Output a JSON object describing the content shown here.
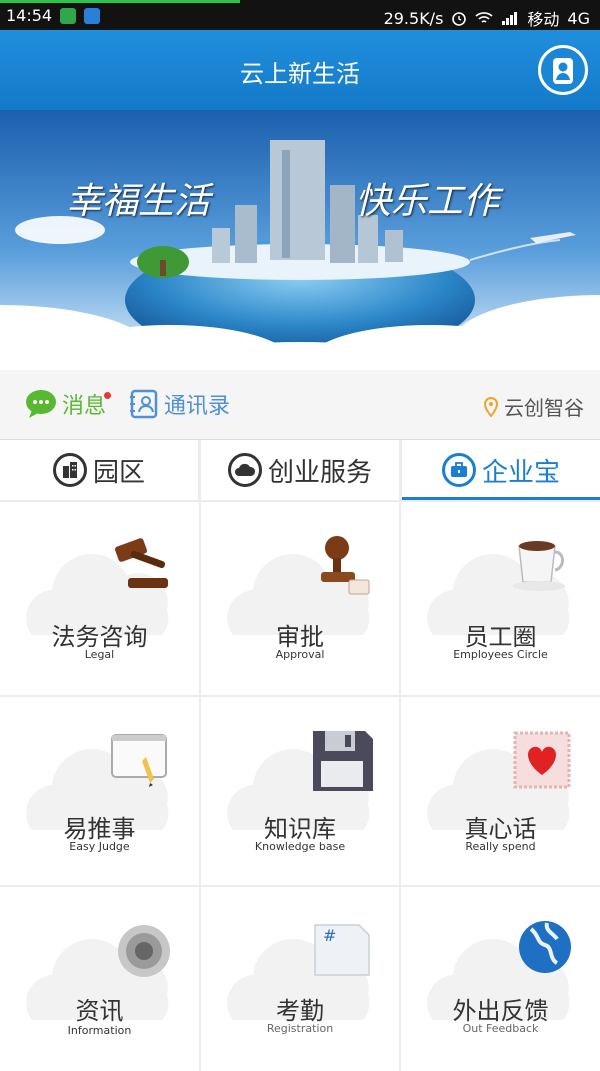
{
  "status_bar": {
    "time": "14:54",
    "speed": "29.5K/s",
    "carrier": "移动",
    "network": "4G",
    "icons": [
      "shield-icon",
      "cloud-app-icon",
      "alarm-icon",
      "wifi-icon",
      "signal-icon",
      "battery-icon"
    ]
  },
  "header": {
    "title": "云上新生活",
    "avatar_icon": "user-profile-icon"
  },
  "banner": {
    "slogan_left": "幸福生活",
    "slogan_right": "快乐工作"
  },
  "infobar": {
    "messages_label": "消息",
    "contacts_label": "通讯录",
    "location_label": "云创智谷"
  },
  "tabs": [
    {
      "label": "园区",
      "icon": "building-icon",
      "active": false
    },
    {
      "label": "创业服务",
      "icon": "cloud-icon",
      "active": false
    },
    {
      "label": "企业宝",
      "icon": "briefcase-icon",
      "active": true
    }
  ],
  "grid": [
    {
      "cn": "法务咨询",
      "en": "Legal",
      "icon": "gavel-icon"
    },
    {
      "cn": "审批",
      "en": "Approval",
      "icon": "stamp-icon"
    },
    {
      "cn": "员工圈",
      "en": "Employees Circle",
      "icon": "coffee-cup-icon"
    },
    {
      "cn": "易推事",
      "en": "Easy Judge",
      "icon": "notepad-pencil-icon"
    },
    {
      "cn": "知识库",
      "en": "Knowledge base",
      "icon": "floppy-disk-icon"
    },
    {
      "cn": "真心话",
      "en": "Really spend",
      "icon": "heart-stamp-icon"
    },
    {
      "cn": "资讯",
      "en": "Information",
      "icon": "speaker-icon"
    },
    {
      "cn": "考勤",
      "en": "Registration",
      "icon": "hashtag-card-icon"
    },
    {
      "cn": "外出反馈",
      "en": "Out Feedback",
      "icon": "globe-icon"
    }
  ],
  "colors": {
    "header_blue": "#1a86d6",
    "active_tab": "#1a7fd0",
    "message_green": "#59b832",
    "contacts_blue": "#4f8fd6"
  }
}
